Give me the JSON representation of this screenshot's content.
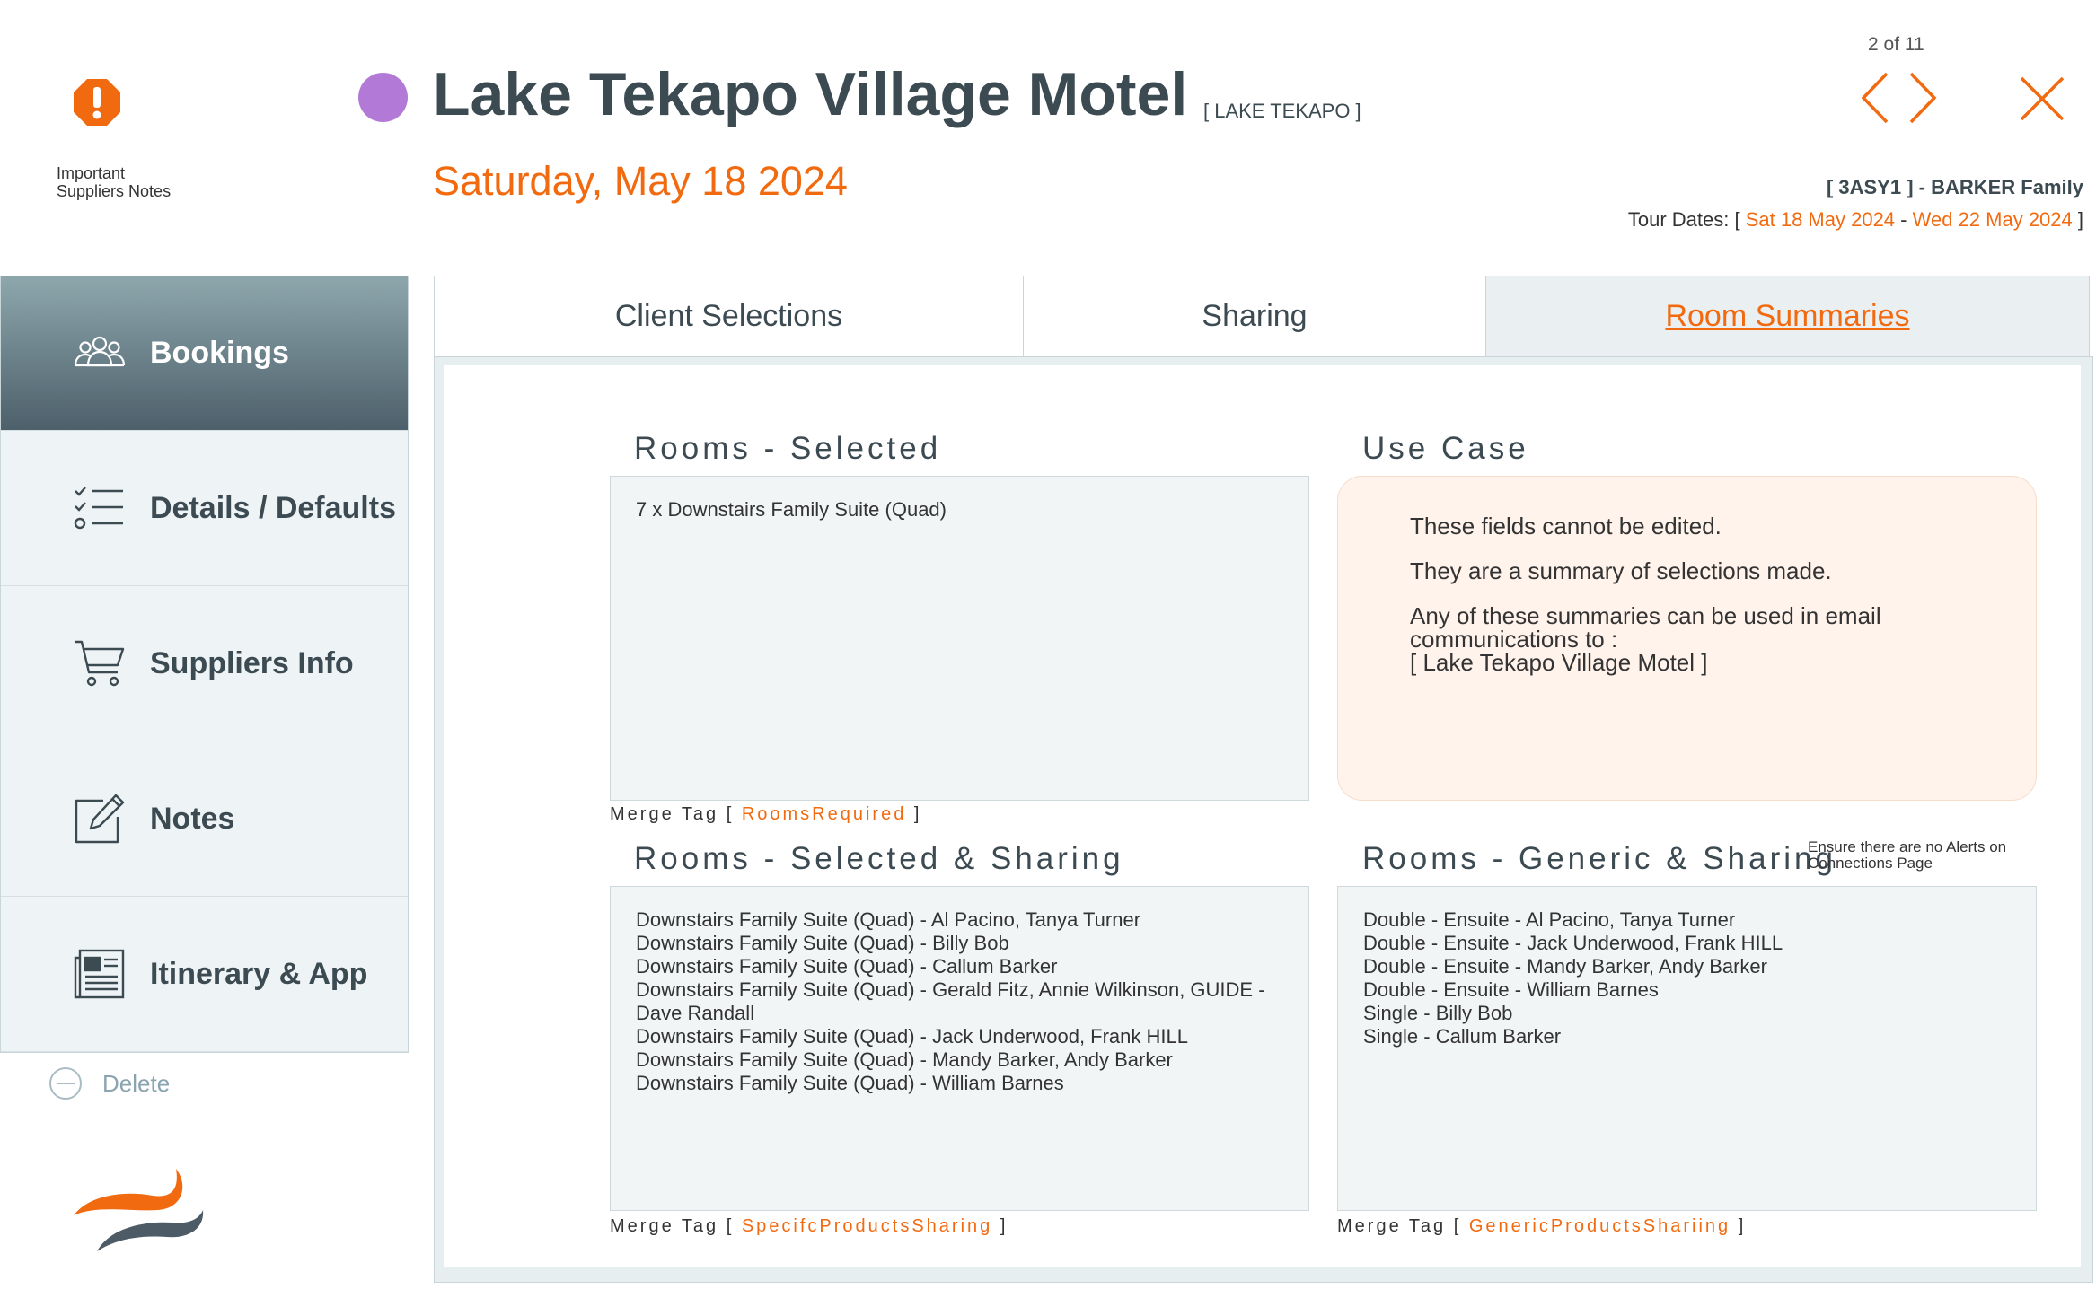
{
  "header": {
    "alert_label_line1": "Important",
    "alert_label_line2": "Suppliers Notes",
    "title": "Lake Tekapo Village Motel",
    "location": "[ LAKE TEKAPO ]",
    "date": "Saturday, May 18 2024",
    "pager": "2 of 11",
    "booking_ref": "[ 3ASY1 ] - BARKER Family",
    "tour_dates_prefix": "Tour Dates: [ ",
    "tour_start": "Sat 18 May 2024",
    "tour_sep": " - ",
    "tour_end": "Wed 22 May 2024",
    "tour_suffix": " ]"
  },
  "sidebar": {
    "items": [
      {
        "label": "Bookings",
        "icon": "people-group-icon",
        "active": true
      },
      {
        "label": "Details / Defaults",
        "icon": "checklist-icon",
        "active": false
      },
      {
        "label": "Suppliers Info",
        "icon": "shopping-cart-icon",
        "active": false
      },
      {
        "label": "Notes",
        "icon": "edit-note-icon",
        "active": false
      },
      {
        "label": "Itinerary & App",
        "icon": "newspaper-icon",
        "active": false
      }
    ],
    "delete_label": "Delete"
  },
  "tabs": [
    {
      "label": "Client Selections",
      "active": false
    },
    {
      "label": "Sharing",
      "active": false
    },
    {
      "label": "Room Summaries",
      "active": true
    }
  ],
  "rooms_selected": {
    "title": "Rooms - Selected",
    "lines": [
      "7 x Downstairs Family Suite (Quad)"
    ],
    "merge_prefix": "Merge Tag [ ",
    "merge_tag": "RoomsRequired",
    "merge_suffix": " ]"
  },
  "use_case": {
    "title": "Use Case",
    "p1": "These fields cannot be edited.",
    "p2": "They are a summary of selections made.",
    "p3a": "Any of these summaries can be used in email",
    "p3b": "communications to :",
    "p3c": "[ Lake Tekapo Village Motel ]"
  },
  "rooms_selected_sharing": {
    "title": "Rooms - Selected & Sharing",
    "lines": [
      "Downstairs Family Suite (Quad) - Al Pacino, Tanya Turner",
      "Downstairs Family Suite (Quad) - Billy Bob",
      "Downstairs Family Suite (Quad) - Callum Barker",
      "Downstairs Family Suite (Quad) - Gerald Fitz, Annie Wilkinson, GUIDE -",
      "Dave Randall",
      "Downstairs Family Suite (Quad) - Jack Underwood, Frank HILL",
      "Downstairs Family Suite (Quad) - Mandy Barker, Andy Barker",
      "Downstairs Family Suite (Quad) - William Barnes"
    ],
    "merge_prefix": "Merge Tag [ ",
    "merge_tag": "SpecifcProductsSharing",
    "merge_suffix": " ]"
  },
  "rooms_generic_sharing": {
    "title": "Rooms - Generic & Sharing",
    "alert_note_line1": "Ensure there are no Alerts on",
    "alert_note_line2": "Connections Page",
    "lines": [
      "Double - Ensuite - Al Pacino, Tanya Turner",
      "Double - Ensuite - Jack Underwood, Frank HILL",
      "Double - Ensuite - Mandy Barker, Andy Barker",
      "Double - Ensuite - William Barnes",
      "Single - Billy Bob",
      "Single - Callum Barker"
    ],
    "merge_prefix": "Merge Tag [ ",
    "merge_tag": "GenericProductsShariing",
    "merge_suffix": " ]"
  },
  "colors": {
    "accent": "#f26a10",
    "dot": "#b27ad6",
    "text": "#3c4a52"
  }
}
